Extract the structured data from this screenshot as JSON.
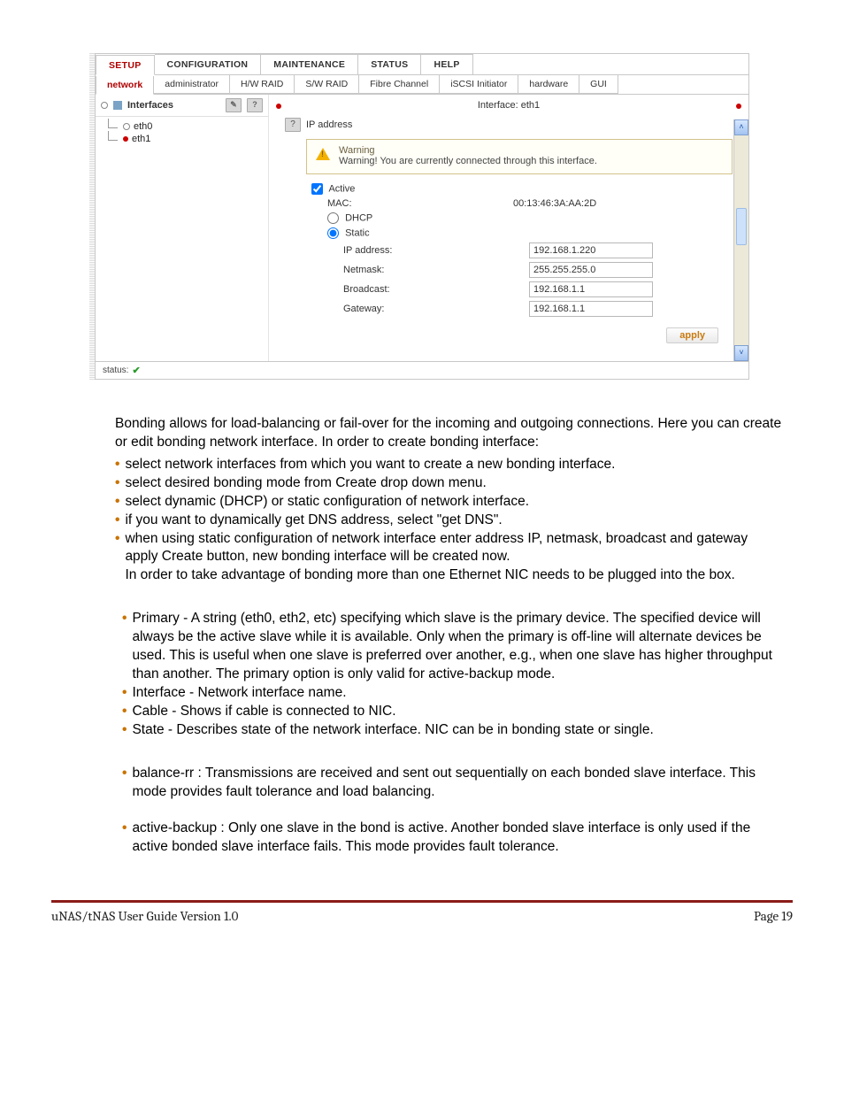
{
  "ui": {
    "primary_tabs": [
      "SETUP",
      "CONFIGURATION",
      "MAINTENANCE",
      "STATUS",
      "HELP"
    ],
    "primary_active": "SETUP",
    "secondary_tabs": [
      "network",
      "administrator",
      "H/W RAID",
      "S/W RAID",
      "Fibre Channel",
      "iSCSI Initiator",
      "hardware",
      "GUI"
    ],
    "secondary_active": "network",
    "sidebar": {
      "title": "Interfaces",
      "items": [
        {
          "label": "eth0",
          "bullet": "open"
        },
        {
          "label": "eth1",
          "bullet": "red"
        }
      ]
    },
    "pane": {
      "heading": "Interface: eth1",
      "section_label": "IP address",
      "warning_title": "Warning",
      "warning_body": "Warning! You are currently connected through this interface.",
      "fields": {
        "active_label": "Active",
        "mac_label": "MAC:",
        "mac_value": "00:13:46:3A:AA:2D",
        "dhcp_label": "DHCP",
        "static_label": "Static",
        "ip_label": "IP address:",
        "ip_value": "192.168.1.220",
        "netmask_label": "Netmask:",
        "netmask_value": "255.255.255.0",
        "broadcast_label": "Broadcast:",
        "broadcast_value": "192.168.1.1",
        "gateway_label": "Gateway:",
        "gateway_value": "192.168.1.1"
      },
      "apply_label": "apply"
    },
    "status_label": "status:"
  },
  "doc": {
    "intro": "Bonding allows for load-balancing or fail-over for the incoming and outgoing connections. Here you can create or edit bonding network interface. In order to create bonding interface:",
    "list1": [
      "select network interfaces from which you want to create a new bonding interface.",
      "select desired bonding mode from Create drop down menu.",
      "select dynamic (DHCP) or static configuration of network interface.",
      "if you want to dynamically get DNS address, select \"get DNS\".",
      "when using static configuration of network interface enter address IP, netmask, broadcast and gateway apply Create button, new bonding interface will be created now.\nIn order to take advantage of bonding more than one Ethernet NIC needs to be plugged into the box."
    ],
    "list2": [
      "Primary - A string (eth0, eth2, etc) specifying which slave is the primary device. The specified device will always be the active slave while it is available. Only when the primary is off-line will alternate devices be used. This is useful when one slave is preferred over another, e.g., when one slave has higher throughput than another. The primary option is only valid for active-backup mode.",
      "Interface - Network interface name.",
      "Cable - Shows if cable is connected to NIC.",
      "State - Describes state of the network interface. NIC can be in bonding state or single."
    ],
    "list3": [
      "balance-rr : Transmissions are received and sent out sequentially on each bonded slave interface. This mode provides fault tolerance and load balancing.",
      "active-backup : Only one slave in the bond is active. Another bonded slave interface is only used if the active bonded slave interface fails. This mode provides fault tolerance."
    ]
  },
  "footer": {
    "left": "uNAS/tNAS User Guide Version 1.0",
    "right": "Page 19"
  }
}
